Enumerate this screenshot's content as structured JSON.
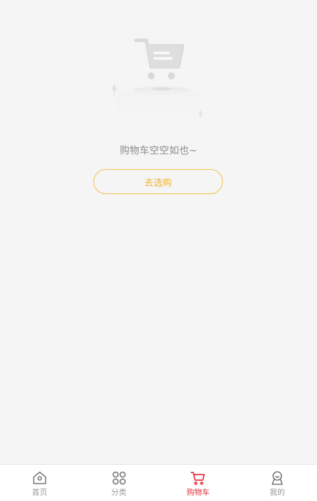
{
  "empty_state": {
    "message": "购物车空空如也~",
    "button_label": "去选购",
    "illustration_icon": "empty-cart-illustration"
  },
  "tab_bar": {
    "active_index": 2,
    "active_color": "#e5323e",
    "inactive_color": "#999999",
    "items": [
      {
        "label": "首页",
        "icon": "home-icon"
      },
      {
        "label": "分类",
        "icon": "category-icon"
      },
      {
        "label": "购物车",
        "icon": "cart-icon"
      },
      {
        "label": "我的",
        "icon": "profile-icon"
      }
    ]
  },
  "colors": {
    "background": "#f5f5f5",
    "button_border": "#f1c24a",
    "button_text": "#f0b429"
  }
}
